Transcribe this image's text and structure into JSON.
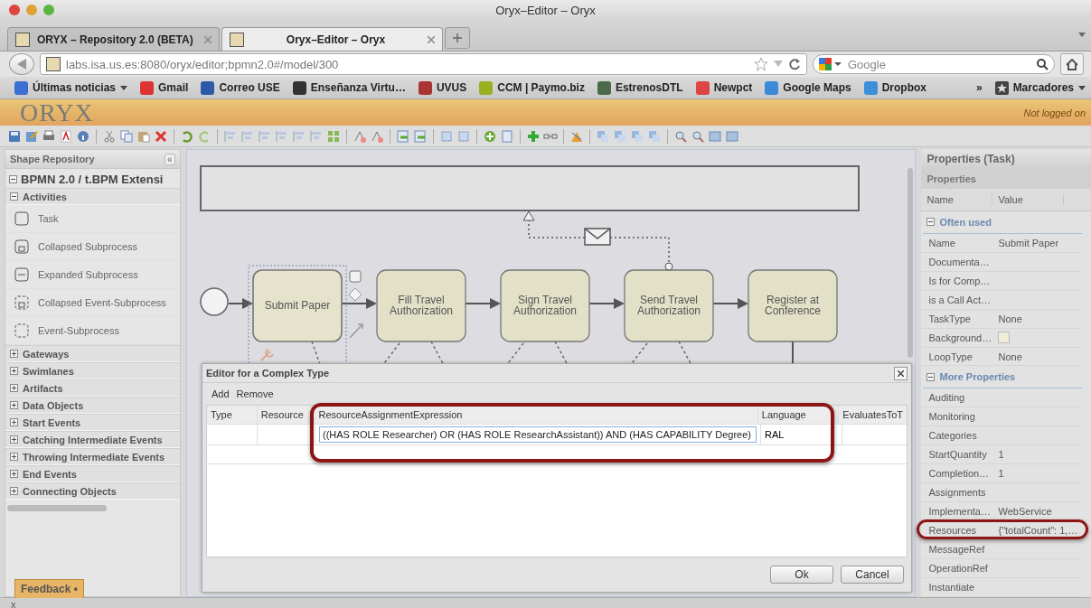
{
  "window": {
    "title": "Oryx–Editor – Oryx"
  },
  "tabs": [
    {
      "label": "ORYX – Repository 2.0 (BETA)",
      "selected": false
    },
    {
      "label": "Oryx–Editor – Oryx",
      "selected": true
    }
  ],
  "address_bar": {
    "url": "labs.isa.us.es:8080/oryx/editor;bpmn2.0#/model/300"
  },
  "search": {
    "placeholder": "Google"
  },
  "bookmarks": [
    {
      "label": "Últimas noticias",
      "kind": "folder"
    },
    {
      "label": "Gmail",
      "kind": "link"
    },
    {
      "label": "Correo USE",
      "kind": "link"
    },
    {
      "label": "Enseñanza Virtu…",
      "kind": "link"
    },
    {
      "label": "UVUS",
      "kind": "link"
    },
    {
      "label": "CCM | Paymo.biz",
      "kind": "link"
    },
    {
      "label": "EstrenosDTL",
      "kind": "link"
    },
    {
      "label": "Newpct",
      "kind": "link"
    },
    {
      "label": "Google Maps",
      "kind": "link"
    },
    {
      "label": "Dropbox",
      "kind": "link"
    }
  ],
  "bookmarks_overflow": "»",
  "bookmarks_menu": {
    "label": "Marcadores"
  },
  "app_header": {
    "logo": "ORYX",
    "login_status": "Not logged on"
  },
  "shape_repository": {
    "title": "Shape Repository",
    "collapse": "«",
    "stencil_set": "BPMN 2.0 / t.BPM Extensi",
    "groups": [
      {
        "label": "Activities",
        "expanded": true,
        "items": [
          "Task",
          "Collapsed Subprocess",
          "Expanded Subprocess",
          "Collapsed Event-Subprocess",
          "Event-Subprocess"
        ]
      },
      {
        "label": "Gateways",
        "expanded": false
      },
      {
        "label": "Swimlanes",
        "expanded": false
      },
      {
        "label": "Artifacts",
        "expanded": false
      },
      {
        "label": "Data Objects",
        "expanded": false
      },
      {
        "label": "Start Events",
        "expanded": false
      },
      {
        "label": "Catching Intermediate Events",
        "expanded": false
      },
      {
        "label": "Throwing Intermediate Events",
        "expanded": false
      },
      {
        "label": "End Events",
        "expanded": false
      },
      {
        "label": "Connecting Objects",
        "expanded": false
      }
    ]
  },
  "feedback": "Feedback •",
  "diagram": {
    "tasks": [
      {
        "label": "Submit Paper",
        "selected": true
      },
      {
        "label": "Fill Travel Authorization",
        "selected": false
      },
      {
        "label": "Sign Travel Authorization",
        "selected": false
      },
      {
        "label": "Send Travel Authorization",
        "selected": false
      },
      {
        "label": "Register at Conference",
        "selected": false
      }
    ]
  },
  "properties": {
    "title": "Properties (Task)",
    "subtitle": "Properties",
    "columns": [
      "Name",
      "Value"
    ],
    "sections": [
      {
        "label": "Often used",
        "expanded": true,
        "rows": [
          {
            "name": "Name",
            "value": "Submit Paper",
            "kind": "text"
          },
          {
            "name": "Documenta…",
            "kind": "text"
          },
          {
            "name": "Is for Comp…",
            "kind": "text"
          },
          {
            "name": "is a Call Act…",
            "kind": "text"
          },
          {
            "name": "TaskType",
            "value": "None",
            "kind": "text"
          },
          {
            "name": "Background…",
            "kind": "swatch",
            "color": "#efecd8"
          },
          {
            "name": "LoopType",
            "value": "None",
            "kind": "text"
          }
        ]
      },
      {
        "label": "More Properties",
        "expanded": true,
        "rows": [
          {
            "name": "Auditing",
            "kind": "text"
          },
          {
            "name": "Monitoring",
            "kind": "text"
          },
          {
            "name": "Categories",
            "kind": "text"
          },
          {
            "name": "StartQuantity",
            "value": "1",
            "kind": "text"
          },
          {
            "name": "Completion…",
            "value": "1",
            "kind": "text"
          },
          {
            "name": "Assignments",
            "kind": "text"
          },
          {
            "name": "Implementa…",
            "value": "WebService",
            "kind": "text"
          },
          {
            "name": "Resources",
            "value": "{\"totalCount\": 1,…",
            "kind": "text"
          },
          {
            "name": "MessageRef",
            "kind": "text"
          },
          {
            "name": "OperationRef",
            "kind": "text"
          },
          {
            "name": "Instantiate",
            "kind": "text"
          }
        ]
      }
    ]
  },
  "dialog": {
    "title": "Editor for a Complex Type",
    "toolbar": [
      "Add",
      "Remove"
    ],
    "columns": [
      "Type",
      "Resource",
      "ResourceAssignmentExpression",
      "Language",
      "EvaluatesToT"
    ],
    "rows": [
      {
        "expression": "((HAS ROLE Researcher) OR (HAS ROLE ResearchAssistant)) AND (HAS CAPABILITY Degree)",
        "language": "RAL"
      }
    ],
    "buttons": [
      "Ok",
      "Cancel"
    ]
  },
  "status_bar": {
    "close": "x"
  }
}
